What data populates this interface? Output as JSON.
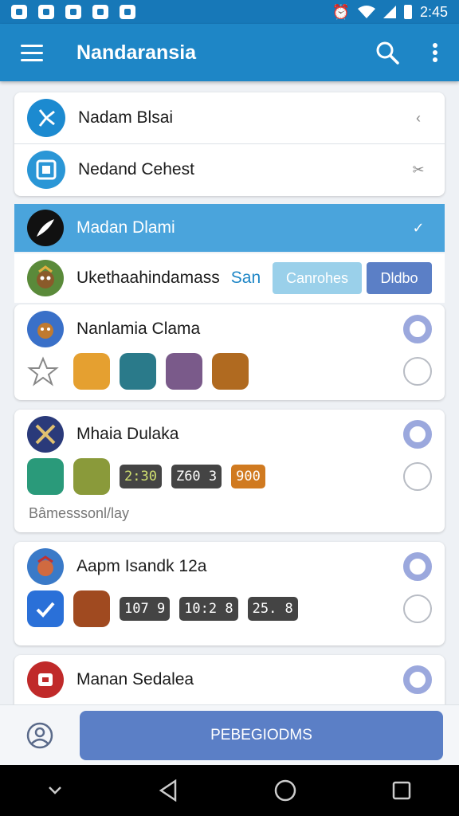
{
  "status_bar": {
    "time": "2:45",
    "icons": [
      "photo-icon",
      "shield-icon",
      "chart-icon",
      "check-icon",
      "edit-icon"
    ],
    "right_icons": [
      "alarm-icon",
      "wifi-icon",
      "signal-icon",
      "battery-icon"
    ]
  },
  "app_bar": {
    "title": "Nandaransia",
    "menu_icon": "menu-icon",
    "search_icon": "search-icon",
    "more_icon": "more-icon"
  },
  "list_top": [
    {
      "label": "Nadam Blsai",
      "trail": "‹"
    },
    {
      "label": "Nedand Cehest",
      "trail": "✂"
    }
  ],
  "highlight": {
    "label": "Madan Dlami",
    "trail": "✓"
  },
  "row5": {
    "label": "Ukethaahindamass",
    "label2": "San",
    "chip_left": "Canrohes",
    "chip_right": "Dldbo"
  },
  "groups": [
    {
      "title": "Nanlamia Clama",
      "icons": [
        "star-icon",
        "lion-icon",
        "farmer-icon",
        "dog-icon",
        "monkey-icon"
      ],
      "tags": [],
      "footnote": ""
    },
    {
      "title": "Mhaia Dulaka",
      "icons": [
        "feather-icon",
        "bag-icon"
      ],
      "tags": [
        "2:30",
        "Z60 3",
        "900"
      ],
      "footnote": "Bâmesssonl/lay"
    },
    {
      "title": "Aapm Isandk 12a",
      "icons": [
        "check-icon",
        "card-icon"
      ],
      "tags": [
        "107 9",
        "10:2 8",
        "25. 8"
      ],
      "footnote": ""
    },
    {
      "title": "Manan Sedalea",
      "icons": [],
      "tags": [],
      "footnote": ""
    }
  ],
  "bottom": {
    "button_label": "PEBEGIODMS",
    "profile_icon": "profile-icon"
  },
  "nav": [
    "back-chevron-icon",
    "back-triangle-icon",
    "home-circle-icon",
    "recents-square-icon"
  ],
  "colors": {
    "primary": "#1e86c6",
    "status": "#1778b8",
    "highlight": "#4aa4dc",
    "button": "#5b7fc6",
    "radio": "#9ba8dd"
  }
}
